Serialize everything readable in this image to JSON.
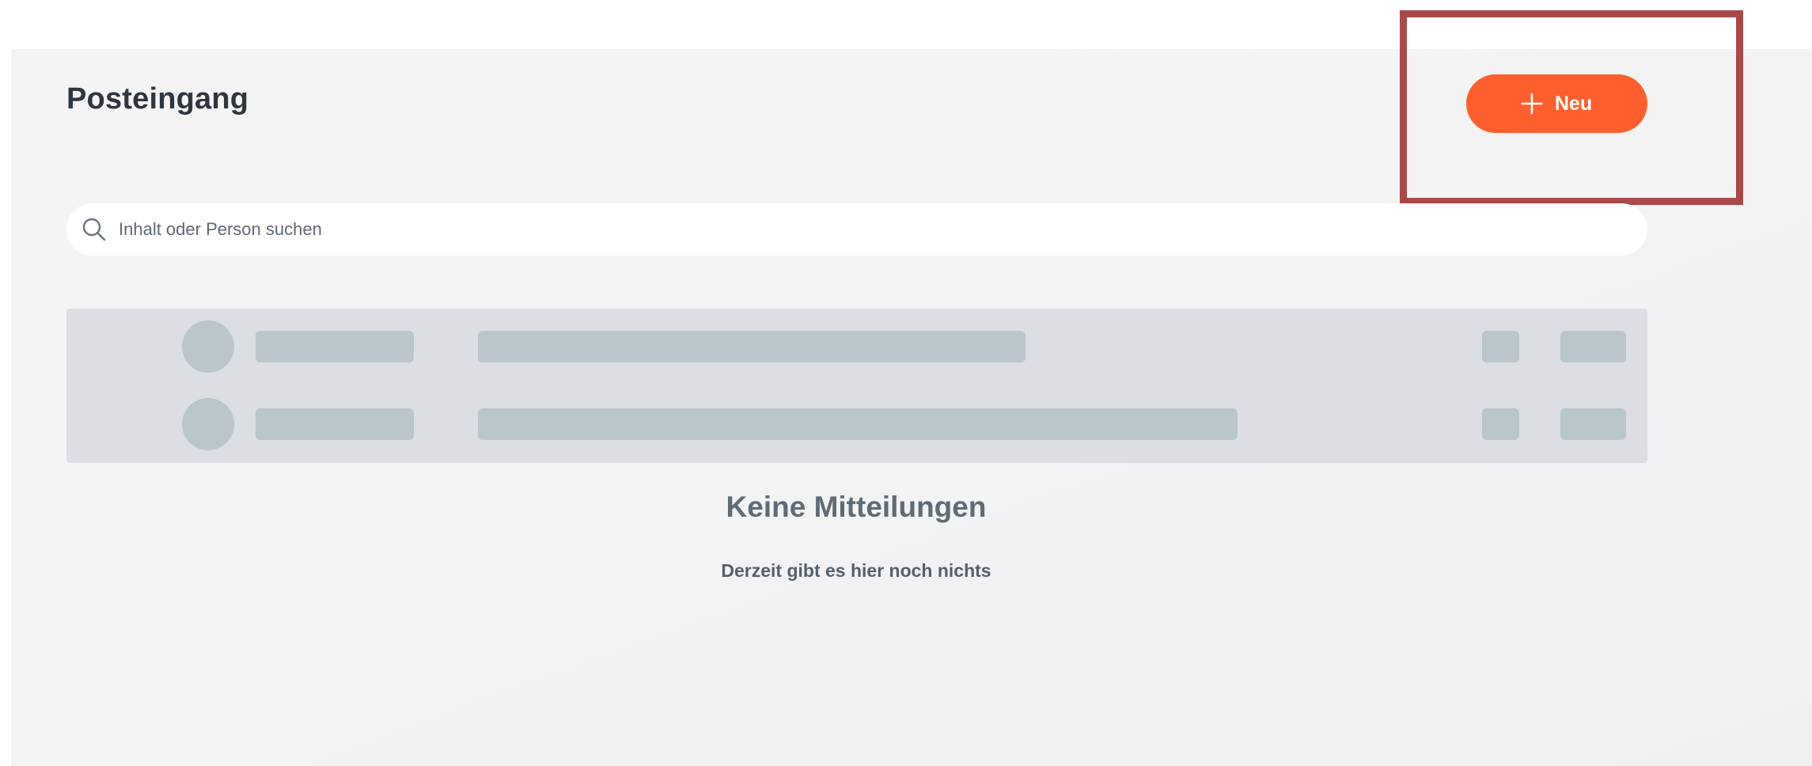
{
  "header": {
    "title": "Posteingang",
    "new_button_label": "Neu",
    "new_button_icon": "plus-icon",
    "accent_color": "#fd602e"
  },
  "search": {
    "placeholder": "Inhalt oder Person suchen",
    "value": "",
    "icon": "search-icon"
  },
  "empty_state": {
    "title": "Keine Mitteilungen",
    "subtitle": "Derzeit gibt es hier noch nichts"
  },
  "annotation": {
    "highlight_color": "#a94a4a"
  }
}
